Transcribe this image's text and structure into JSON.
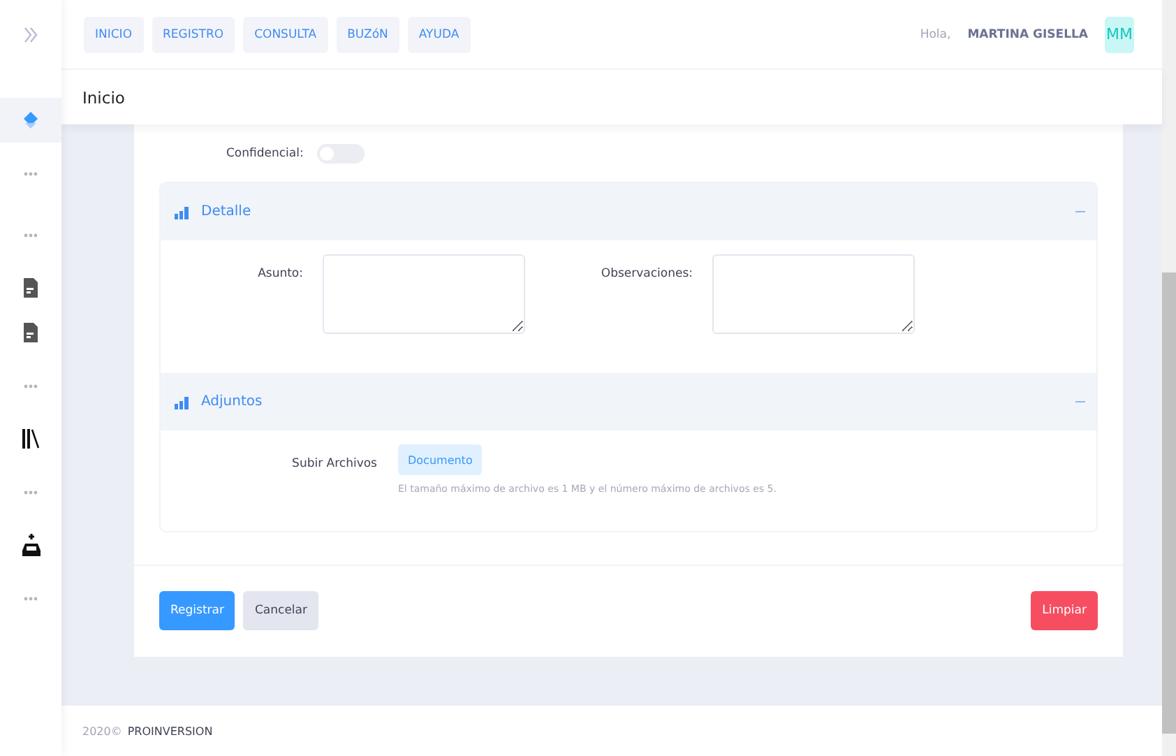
{
  "sidebar": {
    "items": [
      {
        "kind": "layers",
        "selected": true
      },
      {
        "kind": "dots",
        "selected": false
      },
      {
        "kind": "dots",
        "selected": false
      },
      {
        "kind": "document",
        "selected": false
      },
      {
        "kind": "document",
        "selected": false
      },
      {
        "kind": "dots",
        "selected": false
      },
      {
        "kind": "books",
        "selected": false
      },
      {
        "kind": "dots",
        "selected": false
      },
      {
        "kind": "inbox",
        "selected": false
      },
      {
        "kind": "dots",
        "selected": false
      }
    ]
  },
  "nav": [
    "INICIO",
    "REGISTRO",
    "CONSULTA",
    "BUZóN",
    "AYUDA"
  ],
  "user": {
    "greeting": "Hola,",
    "name": "MARTINA GISELLA",
    "initials": "MM"
  },
  "page_title": "Inicio",
  "confidential": {
    "label": "Confidencial:",
    "on": false
  },
  "sections": [
    {
      "title": "Detalle",
      "expanded": true,
      "kind": "fields",
      "fields": [
        {
          "label": "Asunto:"
        },
        {
          "label": "Observaciones:"
        }
      ]
    },
    {
      "title": "Adjuntos",
      "expanded": true,
      "kind": "upload",
      "label": "Subir Archivos",
      "button": "Documento",
      "hint": "El tamaño máximo de archivo es 1 MB y el número máximo de archivos es 5."
    }
  ],
  "actions": [
    {
      "label": "Registrar",
      "kind": "primary"
    },
    {
      "label": "Cancelar",
      "kind": "secondary"
    },
    {
      "label": "Limpiar",
      "kind": "danger"
    }
  ],
  "footer": {
    "year": "2020©",
    "company": "PROINVERSION"
  }
}
